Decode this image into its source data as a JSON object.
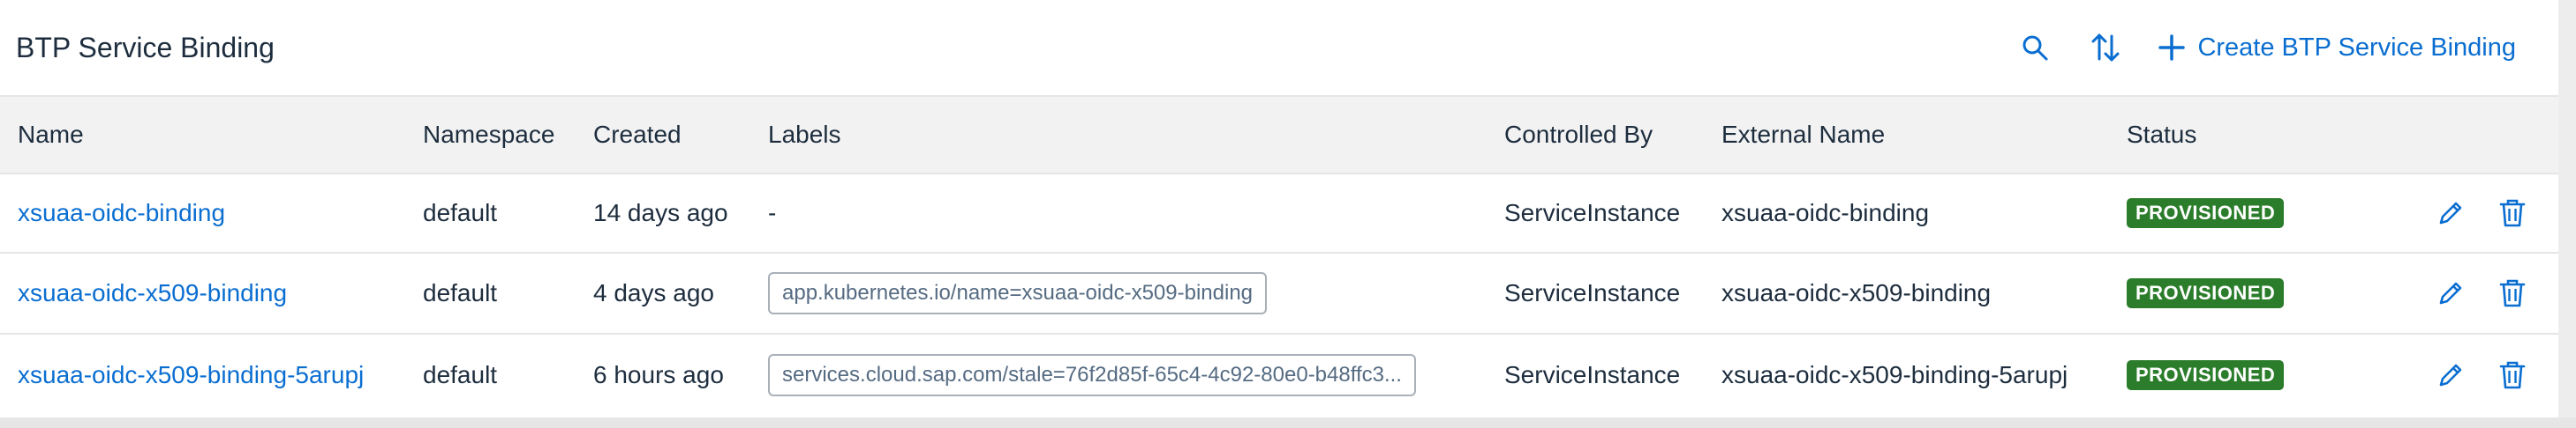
{
  "header": {
    "title": "BTP Service Binding",
    "create_label": "Create BTP Service Binding"
  },
  "columns": {
    "name": "Name",
    "namespace": "Namespace",
    "created": "Created",
    "labels": "Labels",
    "controlled_by": "Controlled By",
    "external_name": "External Name",
    "status": "Status"
  },
  "rows": [
    {
      "name": "xsuaa-oidc-binding",
      "namespace": "default",
      "created": "14 days ago",
      "labels": "-",
      "controlled_by": "ServiceInstance",
      "external_name": "xsuaa-oidc-binding",
      "status": "PROVISIONED"
    },
    {
      "name": "xsuaa-oidc-x509-binding",
      "namespace": "default",
      "created": "4 days ago",
      "labels": "app.kubernetes.io/name=xsuaa-oidc-x509-binding",
      "controlled_by": "ServiceInstance",
      "external_name": "xsuaa-oidc-x509-binding",
      "status": "PROVISIONED"
    },
    {
      "name": "xsuaa-oidc-x509-binding-5arupj",
      "namespace": "default",
      "created": "6 hours ago",
      "labels": "services.cloud.sap.com/stale=76f2d85f-65c4-4c92-80e0-b48ffc3...",
      "controlled_by": "ServiceInstance",
      "external_name": "xsuaa-oidc-x509-binding-5arupj",
      "status": "PROVISIONED"
    }
  ],
  "colors": {
    "accent": "#0a6ed1",
    "status_success": "#2b7d2b",
    "header_bg": "#f2f2f2",
    "text": "#1d2d3e"
  },
  "icons": [
    "search-icon",
    "sort-icon",
    "plus-icon",
    "edit-icon",
    "delete-icon"
  ]
}
